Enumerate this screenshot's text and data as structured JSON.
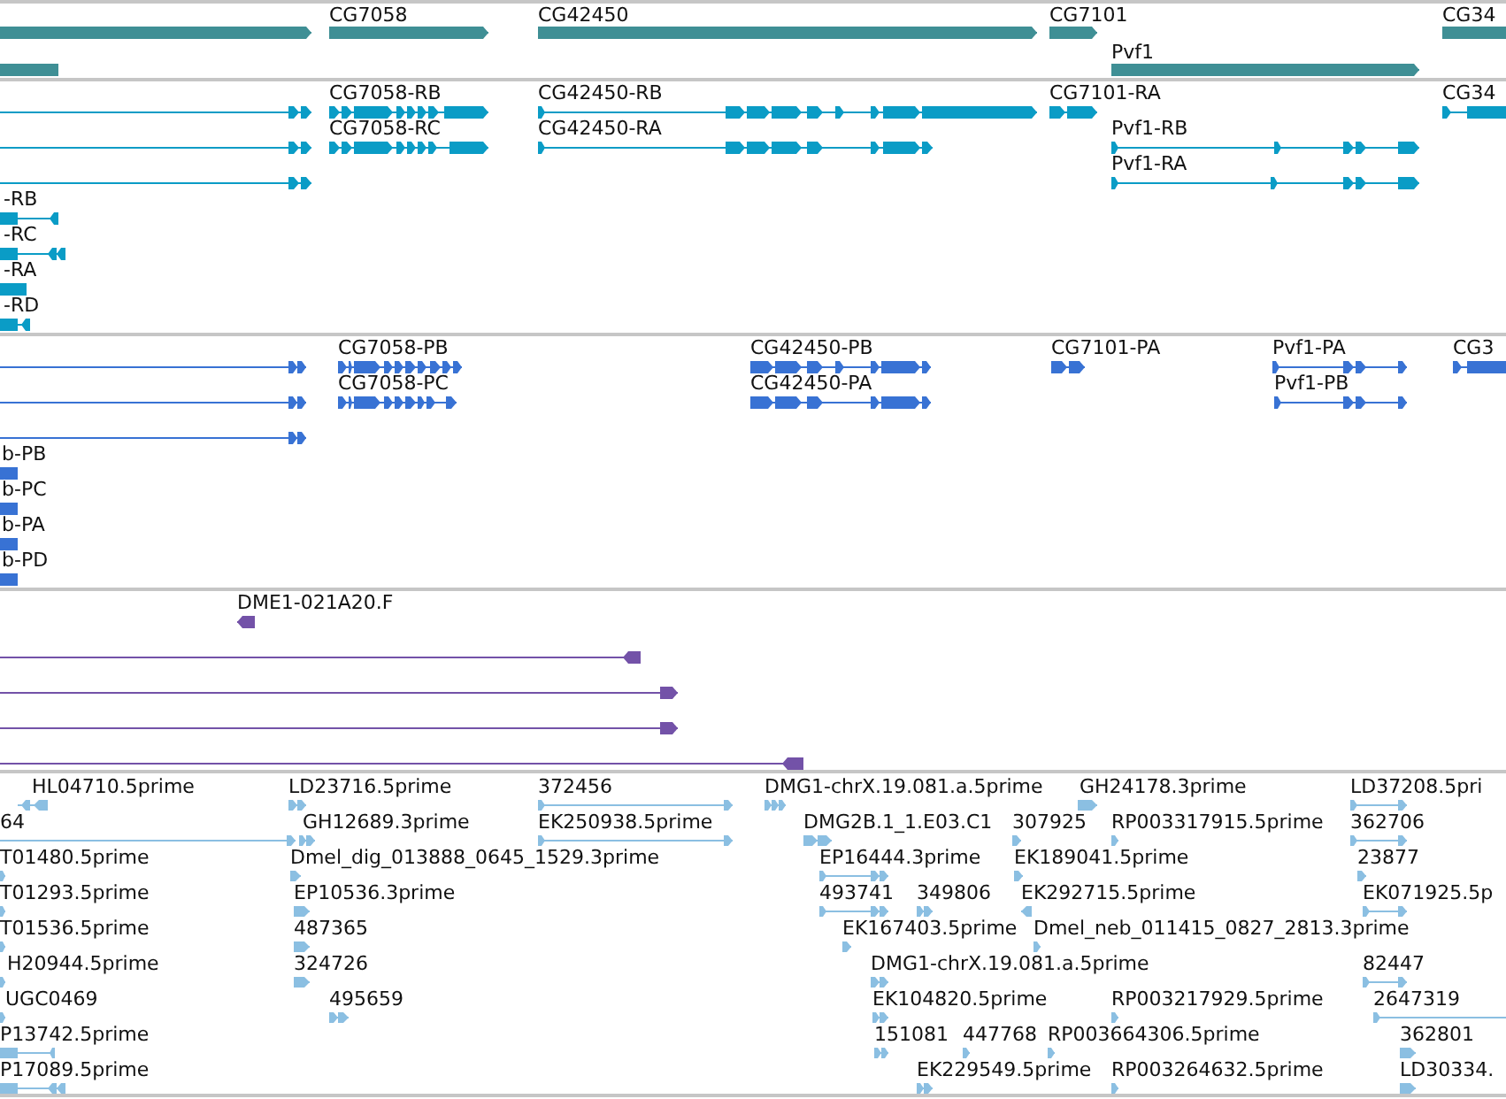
{
  "tracks": [
    {
      "kind": "gene",
      "features": [
        {
          "reverse": false
        },
        {
          "label": "CG7058",
          "reverse": false
        },
        {
          "label": "CG42450",
          "reverse": false
        },
        {
          "label": "CG7101",
          "reverse": false
        },
        {
          "label": "CG34",
          "reverse": false
        },
        {
          "reverse": true
        },
        {
          "label": "Pvf1",
          "reverse": false
        }
      ]
    },
    {
      "kind": "transcript",
      "features": [
        {
          "reverse": false
        },
        {
          "label": "CG7058-RB",
          "reverse": false
        },
        {
          "label": "CG42450-RB",
          "reverse": false
        },
        {
          "label": "CG7101-RA",
          "reverse": false
        },
        {
          "label": "CG34",
          "reverse": false
        },
        {
          "reverse": false
        },
        {
          "label": "CG7058-RC",
          "reverse": false
        },
        {
          "label": "CG42450-RA",
          "reverse": false
        },
        {
          "label": "Pvf1-RB",
          "reverse": false
        },
        {
          "reverse": false
        },
        {
          "label": "Pvf1-RA",
          "reverse": false
        },
        {
          "label": "-RB",
          "reverse": true
        },
        {
          "label": "-RC",
          "reverse": true
        },
        {
          "label": "-RA",
          "reverse": true
        },
        {
          "label": "-RD",
          "reverse": true
        }
      ]
    },
    {
      "kind": "protein",
      "features": [
        {
          "reverse": false
        },
        {
          "label": "CG7058-PB",
          "reverse": false
        },
        {
          "label": "CG42450-PB",
          "reverse": false
        },
        {
          "label": "CG7101-PA",
          "reverse": false
        },
        {
          "label": "Pvf1-PA",
          "reverse": false
        },
        {
          "label": "CG3",
          "reverse": false
        },
        {
          "reverse": false
        },
        {
          "label": "CG7058-PC",
          "reverse": false
        },
        {
          "label": "CG42450-PA",
          "reverse": false
        },
        {
          "label": "Pvf1-PB",
          "reverse": false
        },
        {
          "reverse": false
        },
        {
          "label": "b-PB",
          "reverse": true
        },
        {
          "label": "b-PC",
          "reverse": true
        },
        {
          "label": "b-PA",
          "reverse": true
        },
        {
          "label": "b-PD",
          "reverse": true
        }
      ]
    },
    {
      "kind": "clone",
      "features": [
        {
          "label": "DME1-021A20.F",
          "reverse": true
        },
        {
          "reverse": true
        },
        {
          "reverse": false
        },
        {
          "reverse": false
        },
        {
          "reverse": true
        }
      ]
    },
    {
      "kind": "est",
      "features": [
        {
          "label": "HL04710.5prime",
          "reverse": true
        },
        {
          "label": "LD23716.5prime",
          "reverse": false
        },
        {
          "label": "372456",
          "reverse": false
        },
        {
          "label": "DMG1-chrX.19.081.a.5prime",
          "reverse": false
        },
        {
          "label": "GH24178.3prime",
          "reverse": false
        },
        {
          "label": "LD37208.5pri",
          "reverse": false
        },
        {
          "label": "64",
          "reverse": false
        },
        {
          "label": "GH12689.3prime",
          "reverse": false
        },
        {
          "label": "EK250938.5prime",
          "reverse": false
        },
        {
          "label": "DMG2B.1_1.E03.C1",
          "reverse": false
        },
        {
          "label": "307925",
          "reverse": false
        },
        {
          "label": "RP003317915.5prime",
          "reverse": false
        },
        {
          "label": "362706",
          "reverse": false
        },
        {
          "label": "T01480.5prime",
          "reverse": false
        },
        {
          "label": "Dmel_dig_013888_0645_1529.3prime",
          "reverse": false
        },
        {
          "label": "EP16444.3prime",
          "reverse": false
        },
        {
          "label": "EK189041.5prime",
          "reverse": false
        },
        {
          "label": "23877",
          "reverse": false
        },
        {
          "label": "T01293.5prime",
          "reverse": false
        },
        {
          "label": "EP10536.3prime",
          "reverse": false
        },
        {
          "label": "493741",
          "reverse": false
        },
        {
          "label": "349806",
          "reverse": false
        },
        {
          "label": "EK292715.5prime",
          "reverse": true
        },
        {
          "label": "EK071925.5p",
          "reverse": false
        },
        {
          "label": "T01536.5prime",
          "reverse": false
        },
        {
          "label": "487365",
          "reverse": false
        },
        {
          "label": "EK167403.5prime",
          "reverse": false
        },
        {
          "label": "Dmel_neb_011415_0827_2813.3prime",
          "reverse": false
        },
        {
          "label": "H20944.5prime",
          "reverse": false
        },
        {
          "label": "324726",
          "reverse": false
        },
        {
          "label": "DMG1-chrX.19.081.a.5prime",
          "reverse": false
        },
        {
          "label": "82447",
          "reverse": false
        },
        {
          "label": "UGC0469",
          "reverse": false
        },
        {
          "label": "495659",
          "reverse": false
        },
        {
          "label": "EK104820.5prime",
          "reverse": false
        },
        {
          "label": "RP003217929.5prime",
          "reverse": false
        },
        {
          "label": "2647319",
          "reverse": false
        },
        {
          "label": "P13742.5prime",
          "reverse": true
        },
        {
          "label": "151081",
          "reverse": false
        },
        {
          "label": "447768",
          "reverse": false
        },
        {
          "label": "RP003664306.5prime",
          "reverse": false
        },
        {
          "label": "362801",
          "reverse": false
        },
        {
          "label": "P17089.5prime",
          "reverse": true
        },
        {
          "label": "EK229549.5prime",
          "reverse": false
        },
        {
          "label": "RP003264632.5prime",
          "reverse": false
        },
        {
          "label": "LD30334.",
          "reverse": false
        }
      ]
    }
  ]
}
